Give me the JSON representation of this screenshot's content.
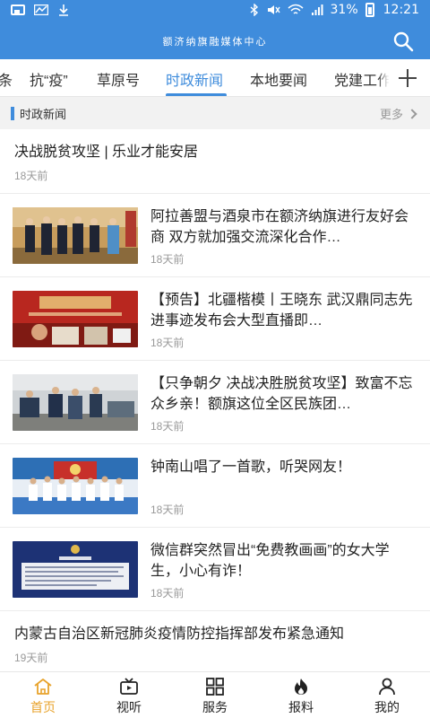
{
  "app": {
    "header_title": "额济纳旗融媒体中心",
    "status": {
      "battery": "31%",
      "time": "12:21"
    }
  },
  "tabs": [
    {
      "label": "条"
    },
    {
      "label": "抗“疫”"
    },
    {
      "label": "草原号"
    },
    {
      "label": "时政新闻",
      "active": true
    },
    {
      "label": "本地要闻"
    },
    {
      "label": "党建工作"
    }
  ],
  "section": {
    "title": "时政新闻",
    "more": "更多"
  },
  "news": [
    {
      "title": "决战脱贫攻坚 | 乐业才能安居",
      "time": "18天前",
      "has_image": false
    },
    {
      "title": "阿拉善盟与酒泉市在额济纳旗进行友好会商 双方就加强交流深化合作…",
      "time": "18天前",
      "has_image": true,
      "image_icon": "meeting-photo"
    },
    {
      "title": "【预告】北疆楷模丨王晓东 武汉鼎同志先进事迹发布会大型直播即…",
      "time": "18天前",
      "has_image": true,
      "image_icon": "poster-photo"
    },
    {
      "title": "【只争朝夕 决战决胜脱贫攻坚】致富不忘众乡亲！额旗这位全区民族团…",
      "time": "18天前",
      "has_image": true,
      "image_icon": "workshop-photo"
    },
    {
      "title": "钟南山唱了一首歌，听哭网友！",
      "time": "18天前",
      "has_image": true,
      "image_icon": "group-photo"
    },
    {
      "title": "微信群突然冒出“免费教画画”的女大学生，小心有诈！",
      "time": "18天前",
      "has_image": true,
      "image_icon": "police-notice-photo"
    },
    {
      "title": "内蒙古自治区新冠肺炎疫情防控指挥部发布紧急通知",
      "time": "19天前",
      "has_image": false
    }
  ],
  "bottom_nav": [
    {
      "label": "首页",
      "icon": "home-icon",
      "active": true
    },
    {
      "label": "视听",
      "icon": "tv-icon"
    },
    {
      "label": "服务",
      "icon": "grid-icon"
    },
    {
      "label": "报料",
      "icon": "fire-icon"
    },
    {
      "label": "我的",
      "icon": "user-icon"
    }
  ],
  "colors": {
    "accent": "#3f8cdc",
    "active_nav": "#e8a32c"
  }
}
